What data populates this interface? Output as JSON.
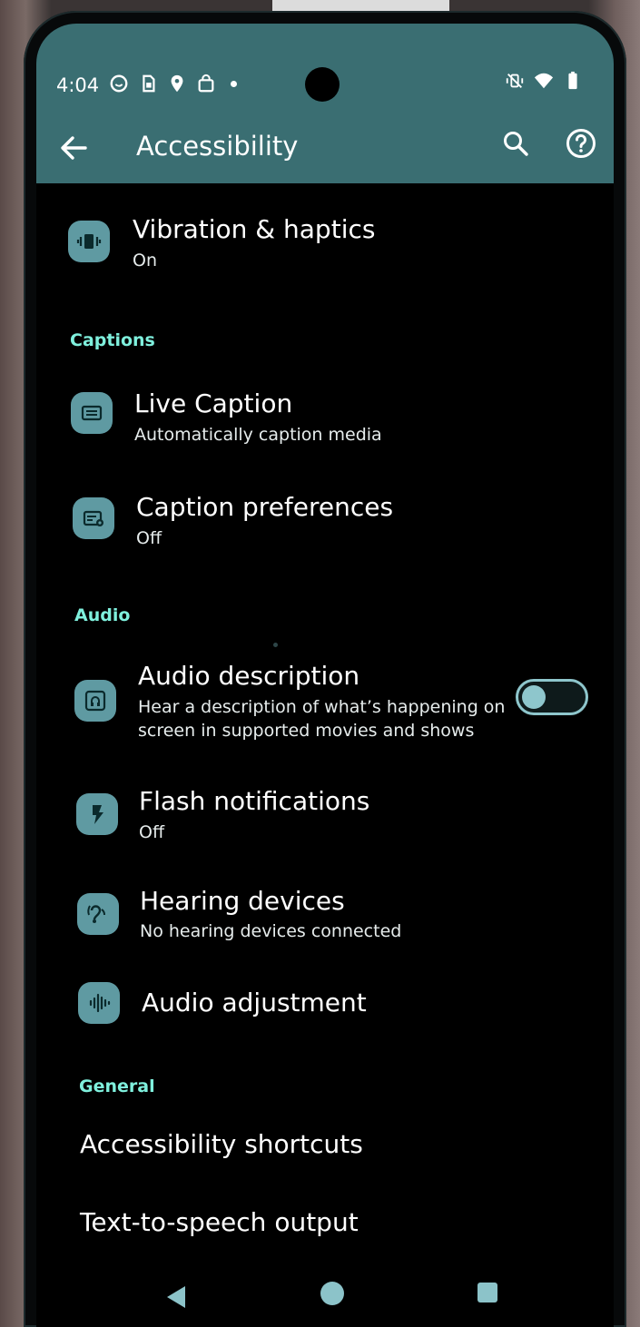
{
  "status_bar": {
    "time": "4:04",
    "left_icons": [
      "smiley-icon",
      "sim-icon",
      "location-icon",
      "bag-icon",
      "more-notifications-dot"
    ],
    "right_icons": [
      "vibrate-off-icon",
      "wifi-icon",
      "battery-icon"
    ]
  },
  "appbar": {
    "title": "Accessibility",
    "back_icon": "arrow-back-icon",
    "search_icon": "search-icon",
    "help_icon": "help-icon"
  },
  "items": {
    "vibration": {
      "title": "Vibration & haptics",
      "subtitle": "On",
      "icon": "vibration-icon"
    },
    "live_caption": {
      "title": "Live Caption",
      "subtitle": "Automatically caption media",
      "icon": "caption-icon"
    },
    "caption_prefs": {
      "title": "Caption preferences",
      "subtitle": "Off",
      "icon": "caption-settings-icon"
    },
    "audio_description": {
      "title": "Audio description",
      "subtitle_line1": "Hear a description of what’s happening on",
      "subtitle_line2": "screen in supported movies and shows",
      "icon": "audio-description-icon",
      "toggle_on": false
    },
    "flash_notifications": {
      "title": "Flash notifications",
      "subtitle": "Off",
      "icon": "flash-icon"
    },
    "hearing_devices": {
      "title": "Hearing devices",
      "subtitle": "No hearing devices connected",
      "icon": "hearing-icon"
    },
    "audio_adjustment": {
      "title": "Audio adjustment",
      "icon": "waveform-icon"
    },
    "shortcuts": {
      "title": "Accessibility shortcuts"
    },
    "tts": {
      "title": "Text-to-speech output"
    }
  },
  "sections": {
    "captions": "Captions",
    "audio": "Audio",
    "general": "General"
  },
  "nav": {
    "back": "nav-back-icon",
    "home": "nav-home-icon",
    "recents": "nav-recents-icon"
  },
  "colors": {
    "header": "#3a6e72",
    "accent": "#7ff0dd",
    "icon_bg": "#5f9aa2"
  }
}
